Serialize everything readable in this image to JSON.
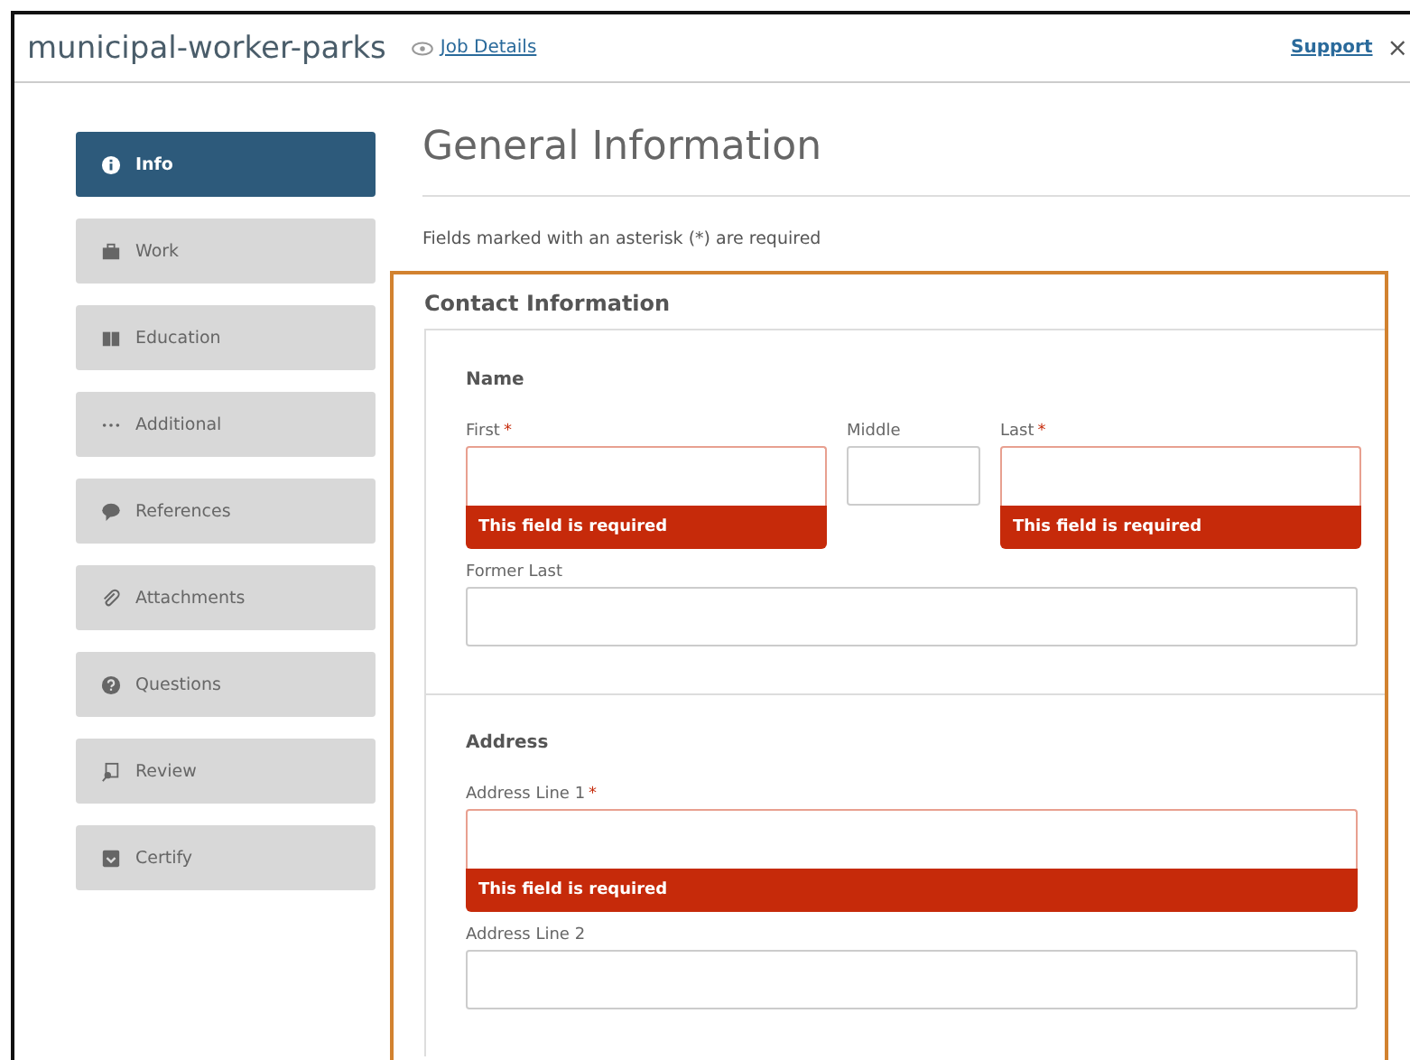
{
  "header": {
    "title": "municipal-worker-parks",
    "job_link": "Job Details",
    "support_link": "Support",
    "close": "×"
  },
  "sidebar": {
    "items": [
      {
        "label": "Info",
        "kind": "info",
        "selected": true
      },
      {
        "label": "Work",
        "kind": "work",
        "selected": false
      },
      {
        "label": "Education",
        "kind": "education",
        "selected": false
      },
      {
        "label": "Additional",
        "kind": "additional",
        "selected": false
      },
      {
        "label": "References",
        "kind": "references",
        "selected": false
      },
      {
        "label": "Attachments",
        "kind": "attachments",
        "selected": false
      },
      {
        "label": "Questions",
        "kind": "questions",
        "selected": false
      },
      {
        "label": "Review",
        "kind": "review",
        "selected": false
      },
      {
        "label": "Certify",
        "kind": "certify",
        "selected": false
      }
    ]
  },
  "page_title": "General Information",
  "note": "Fields marked with an asterisk (*) are required",
  "section": {
    "title": "Contact Information",
    "groups": [
      {
        "title": "Name",
        "rows": [
          [
            {
              "label": "First",
              "required_mark": "*",
              "error": "This field is required"
            },
            {
              "label": "Middle"
            },
            {
              "label": "Last",
              "required_mark": "*",
              "error": "This field is required"
            }
          ],
          [
            {
              "label": "Former Last"
            }
          ]
        ]
      },
      {
        "title": "Address",
        "rows": [
          [
            {
              "label": "Address Line 1",
              "required_mark": "*",
              "error": "This field is required"
            }
          ],
          [
            {
              "label": "Address Line 2"
            }
          ]
        ]
      }
    ]
  }
}
